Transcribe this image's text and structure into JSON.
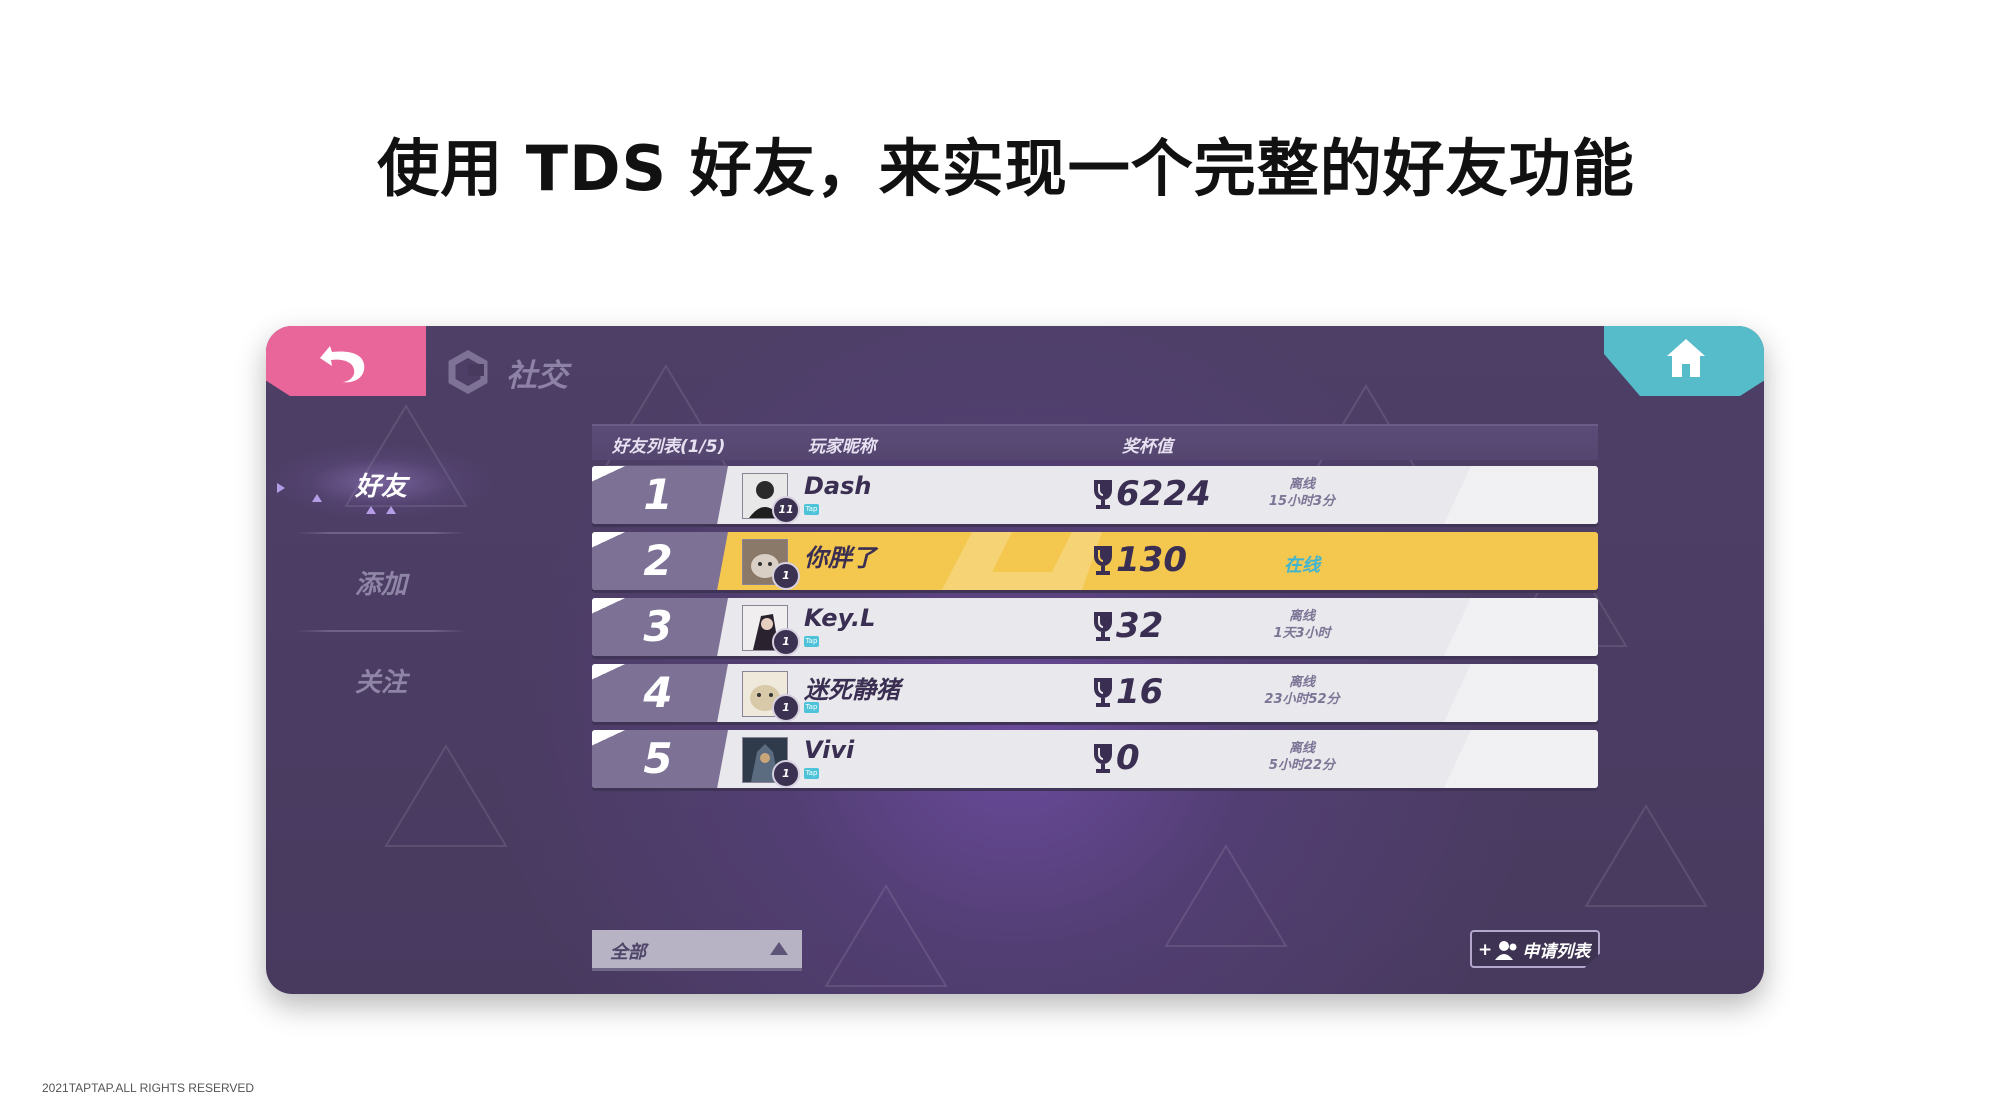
{
  "slide": {
    "title": "使用 TDS 好友，来实现一个完整的好友功能",
    "footer": "2021TAPTAP.ALL RIGHTS RESERVED"
  },
  "game": {
    "header_title": "社交",
    "nav": [
      {
        "label": "好友",
        "active": true
      },
      {
        "label": "添加",
        "active": false
      },
      {
        "label": "关注",
        "active": false
      }
    ],
    "table_headers": {
      "list": "好友列表(1/5)",
      "name": "玩家昵称",
      "trophy": "奖杯值"
    },
    "tap_tag": "Tap",
    "friends": [
      {
        "rank": "1",
        "name": "Dash",
        "level": "11",
        "trophies": "6224",
        "status_line1": "离线",
        "status_line2": "15小时3分",
        "online": false
      },
      {
        "rank": "2",
        "name": "你胖了",
        "level": "1",
        "trophies": "130",
        "status_line1": "在线",
        "status_line2": "",
        "online": true
      },
      {
        "rank": "3",
        "name": "Key.L",
        "level": "1",
        "trophies": "32",
        "status_line1": "离线",
        "status_line2": "1天3小时",
        "online": false
      },
      {
        "rank": "4",
        "name": "迷死静猪",
        "level": "1",
        "trophies": "16",
        "status_line1": "离线",
        "status_line2": "23小时52分",
        "online": false
      },
      {
        "rank": "5",
        "name": "Vivi",
        "level": "1",
        "trophies": "0",
        "status_line1": "离线",
        "status_line2": "5小时22分",
        "online": false
      }
    ],
    "filter": {
      "selected": "全部"
    },
    "request_button": {
      "label": "申请列表",
      "prefix": "+"
    },
    "colors": {
      "back_tab": "#e9669b",
      "home_tab": "#56bcc9",
      "highlight_row": "#f4c74f",
      "panel_bg": "#483a5f",
      "online_text": "#3fb5d1"
    },
    "icons": {
      "back": "back-arrow-icon",
      "home": "home-icon",
      "trophy": "trophy-icon",
      "request": "add-user-icon",
      "logo": "social-logo-icon"
    }
  }
}
